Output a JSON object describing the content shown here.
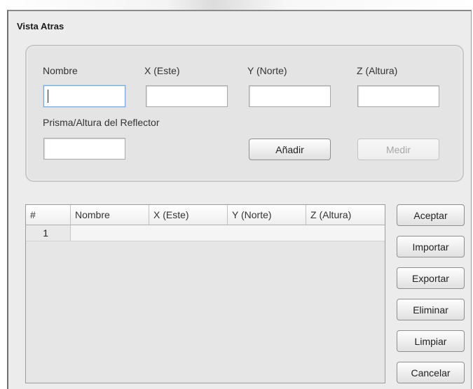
{
  "dialog": {
    "title": "Vista Atras"
  },
  "form": {
    "nombre_label": "Nombre",
    "x_label": "X (Este)",
    "y_label": "Y (Norte)",
    "z_label": "Z (Altura)",
    "prisma_label": "Prisma/Altura del Reflector",
    "nombre_value": "",
    "x_value": "",
    "y_value": "",
    "z_value": "",
    "prisma_value": "",
    "anadir_label": "Añadir",
    "medir_label": "Medir"
  },
  "table": {
    "columns": [
      "#",
      "Nombre",
      "X (Este)",
      "Y (Norte)",
      "Z (Altura)"
    ],
    "rows": [
      {
        "num": "1",
        "nombre": "",
        "x": "",
        "y": "",
        "z": ""
      }
    ]
  },
  "actions": {
    "aceptar": "Aceptar",
    "importar": "Importar",
    "exportar": "Exportar",
    "eliminar": "Eliminar",
    "limpiar": "Limpiar",
    "cancelar": "Cancelar"
  }
}
